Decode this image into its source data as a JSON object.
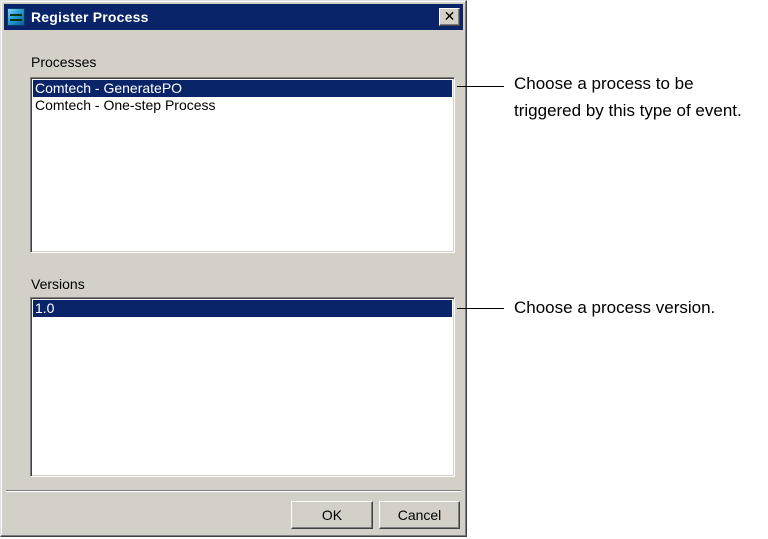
{
  "window": {
    "title": "Register Process",
    "close_label": "✕"
  },
  "processes": {
    "label": "Processes",
    "items": [
      "Comtech - GeneratePO",
      "Comtech - One-step Process"
    ],
    "selected_index": 0
  },
  "versions": {
    "label": "Versions",
    "items": [
      "1.0"
    ],
    "selected_index": 0
  },
  "buttons": {
    "ok_label": "OK",
    "cancel_label": "Cancel"
  },
  "callouts": {
    "process_line1": "Choose a process to be",
    "process_line2": "triggered by this type of event.",
    "version": "Choose a process version."
  },
  "colors": {
    "selection": "#0a246a",
    "dialog_face": "#d4d0c8"
  }
}
